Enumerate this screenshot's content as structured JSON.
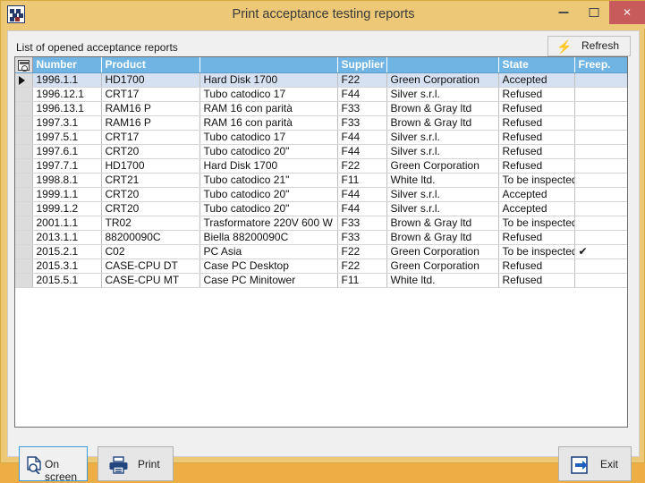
{
  "window": {
    "title": "Print acceptance testing reports",
    "icon": "app-checkerboard-icon",
    "minimize_label": "",
    "maximize_label": "",
    "close_label": "×"
  },
  "panel": {
    "list_label": "List of opened acceptance reports",
    "refresh": {
      "label": "Refresh",
      "icon": "lightning-bolt-icon"
    }
  },
  "grid": {
    "columns": [
      {
        "key": "sel",
        "label": ""
      },
      {
        "key": "number",
        "label": "Number"
      },
      {
        "key": "product",
        "label": "Product"
      },
      {
        "key": "desc",
        "label": ""
      },
      {
        "key": "supplier",
        "label": "Supplier"
      },
      {
        "key": "supplier_name",
        "label": ""
      },
      {
        "key": "state",
        "label": "State"
      },
      {
        "key": "freep",
        "label": "Freep."
      }
    ],
    "selected_row_index": 0,
    "rows": [
      {
        "number": "1996.1.1",
        "product": "HD1700",
        "desc": "Hard Disk 1700",
        "supplier": "F22",
        "supplier_name": "Green Corporation",
        "state": "Accepted",
        "freep": ""
      },
      {
        "number": "1996.12.1",
        "product": "CRT17",
        "desc": "Tubo catodico 17",
        "supplier": "F44",
        "supplier_name": "Silver s.r.l.",
        "state": "Refused",
        "freep": ""
      },
      {
        "number": "1996.13.1",
        "product": "RAM16 P",
        "desc": "RAM 16 con parità",
        "supplier": "F33",
        "supplier_name": "Brown & Gray ltd",
        "state": "Refused",
        "freep": ""
      },
      {
        "number": "1997.3.1",
        "product": "RAM16 P",
        "desc": "RAM 16 con parità",
        "supplier": "F33",
        "supplier_name": "Brown & Gray ltd",
        "state": "Refused",
        "freep": ""
      },
      {
        "number": "1997.5.1",
        "product": "CRT17",
        "desc": "Tubo catodico 17",
        "supplier": "F44",
        "supplier_name": "Silver s.r.l.",
        "state": "Refused",
        "freep": ""
      },
      {
        "number": "1997.6.1",
        "product": "CRT20",
        "desc": "Tubo catodico 20\"",
        "supplier": "F44",
        "supplier_name": "Silver s.r.l.",
        "state": "Refused",
        "freep": ""
      },
      {
        "number": "1997.7.1",
        "product": "HD1700",
        "desc": "Hard Disk 1700",
        "supplier": "F22",
        "supplier_name": "Green Corporation",
        "state": "Refused",
        "freep": ""
      },
      {
        "number": "1998.8.1",
        "product": "CRT21",
        "desc": "Tubo catodico 21\"",
        "supplier": "F11",
        "supplier_name": "White ltd.",
        "state": "To be inspected",
        "freep": ""
      },
      {
        "number": "1999.1.1",
        "product": "CRT20",
        "desc": "Tubo catodico 20\"",
        "supplier": "F44",
        "supplier_name": "Silver s.r.l.",
        "state": "Accepted",
        "freep": ""
      },
      {
        "number": "1999.1.2",
        "product": "CRT20",
        "desc": "Tubo catodico 20\"",
        "supplier": "F44",
        "supplier_name": "Silver s.r.l.",
        "state": "Accepted",
        "freep": ""
      },
      {
        "number": "2001.1.1",
        "product": "TR02",
        "desc": "Trasformatore 220V 600 W",
        "supplier": "F33",
        "supplier_name": "Brown & Gray ltd",
        "state": "To be inspected",
        "freep": ""
      },
      {
        "number": "2013.1.1",
        "product": "88200090C",
        "desc": "Biella 88200090C",
        "supplier": "F33",
        "supplier_name": "Brown & Gray ltd",
        "state": "Refused",
        "freep": ""
      },
      {
        "number": "2015.2.1",
        "product": "C02",
        "desc": "PC Asia",
        "supplier": "F22",
        "supplier_name": "Green Corporation",
        "state": "To be inspected",
        "freep": "✔"
      },
      {
        "number": "2015.3.1",
        "product": "CASE-CPU DT",
        "desc": "Case PC Desktop",
        "supplier": "F22",
        "supplier_name": "Green Corporation",
        "state": "Refused",
        "freep": ""
      },
      {
        "number": "2015.5.1",
        "product": "CASE-CPU MT",
        "desc": "Case PC Minitower",
        "supplier": "F11",
        "supplier_name": "White ltd.",
        "state": "Refused",
        "freep": ""
      }
    ]
  },
  "actions": {
    "on_screen": {
      "label": "On screen",
      "icon": "document-preview-icon"
    },
    "print": {
      "label": "Print",
      "icon": "printer-icon"
    },
    "exit": {
      "label": "Exit",
      "icon": "exit-door-icon"
    }
  },
  "colors": {
    "window_chrome": "#ecc877",
    "header_blue": "#70b4e4",
    "selection_blue": "#d5e0f0",
    "accent_blue": "#2f6fc6",
    "close_red": "#c75b5b"
  }
}
